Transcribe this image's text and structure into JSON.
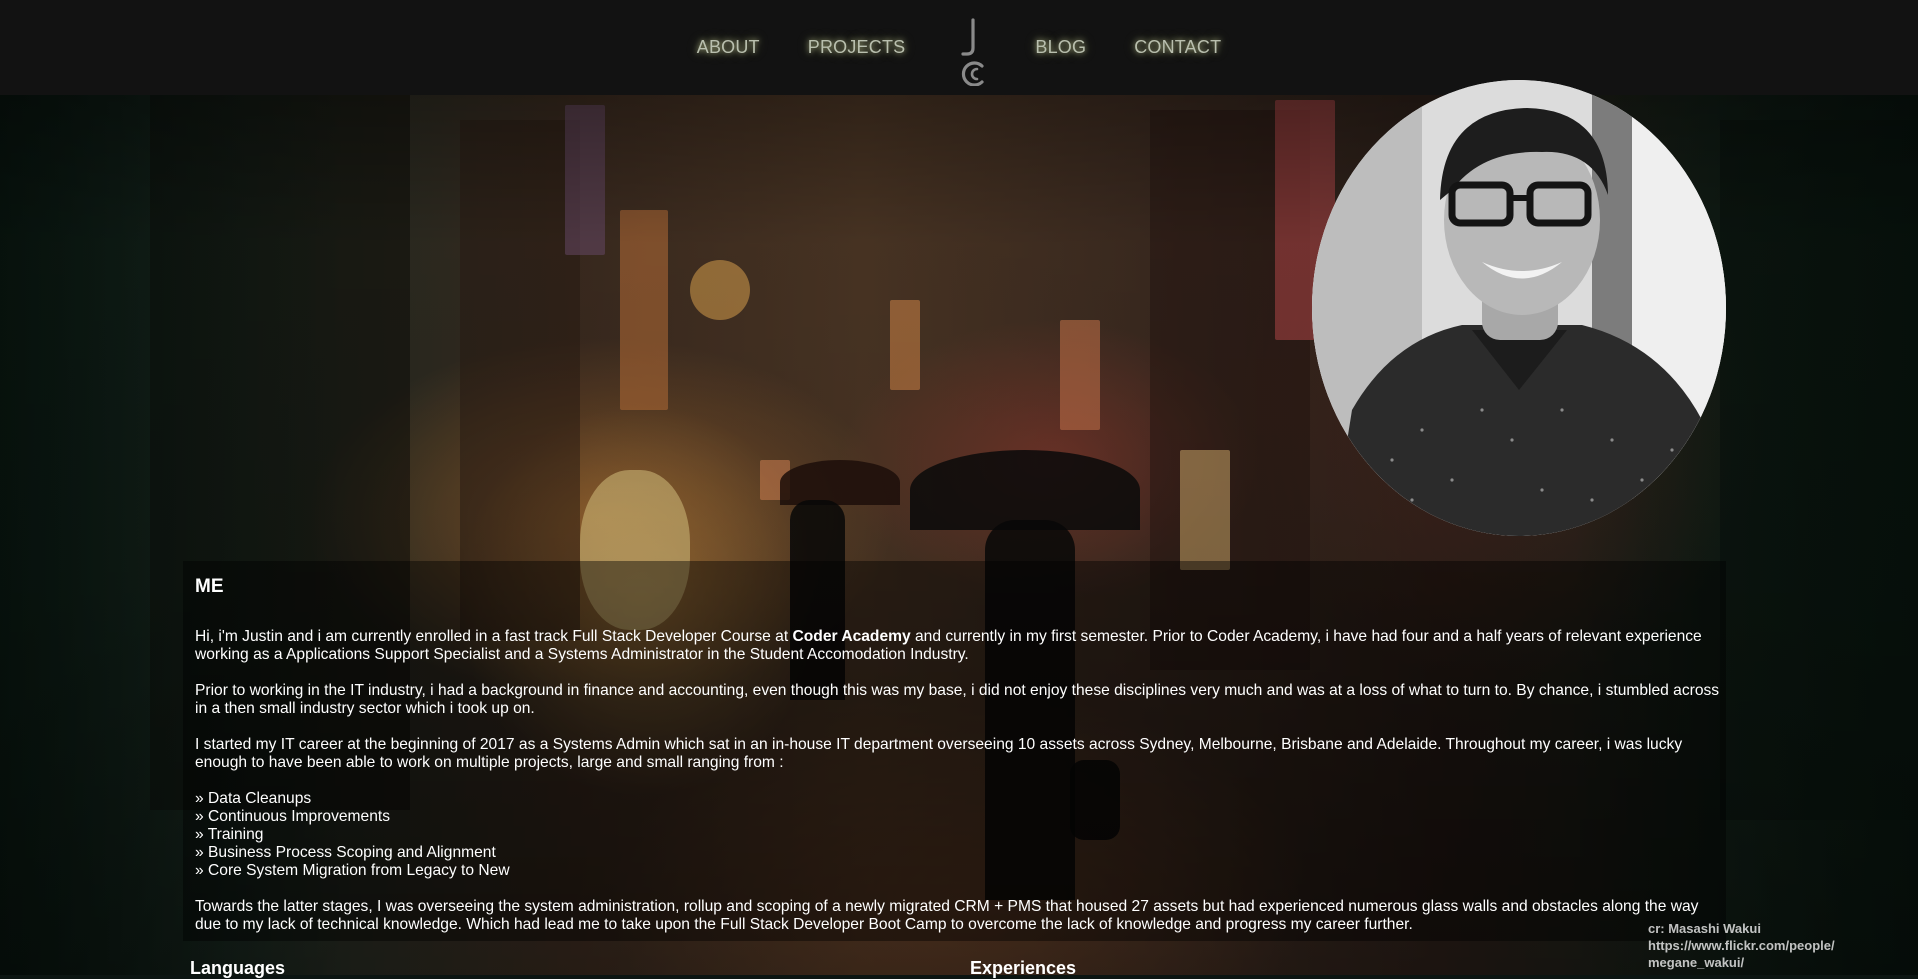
{
  "nav": {
    "links": [
      "ABOUT",
      "PROJECTS",
      "BLOG",
      "CONTACT"
    ],
    "logo_text": "JC"
  },
  "about": {
    "heading": "ME",
    "p1_before": "Hi, i'm Justin and i am currently enrolled in a fast track Full Stack Developer Course at ",
    "p1_bold": "Coder Academy",
    "p1_after": " and currently in my first semester. Prior to Coder Academy, i have had four and a half years of relevant experience working as a Applications Support Specialist and a Systems Administrator in the Student Accomodation Industry.",
    "p2": "Prior to working in the IT industry, i had a background in finance and accounting, even though this was my base, i did not enjoy these disciplines very much and was at a loss of what to turn to. By chance, i stumbled across in a then small industry sector which i took up on.",
    "p3": "I started my IT career at the beginning of 2017 as a Systems Admin which sat in an in-house IT department overseeing 10 assets across Sydney, Melbourne, Brisbane and Adelaide. Throughout my career, i was lucky enough to have been able to work on multiple projects, large and small ranging from :",
    "items": [
      "» Data Cleanups",
      "» Continuous Improvements",
      "» Training",
      "» Business Process Scoping and Alignment",
      "» Core System Migration from Legacy to New"
    ],
    "p4": "Towards the latter stages, I was overseeing the system administration, rollup and scoping of a newly migrated CRM + PMS that housed 27 assets but had experienced numerous glass walls and obstacles along the way due to my lack of technical knowledge. Which had lead me to take upon the Full Stack Developer Boot Camp to overcome the lack of knowledge and progress my career further."
  },
  "sections": {
    "languages": "Languages",
    "experiences": "Experiences"
  },
  "credit": {
    "line1": "cr: Masashi Wakui",
    "line2": "https://www.flickr.com/people/",
    "line3": "megane_wakui/"
  },
  "colors": {
    "nav_bg": "#121212",
    "nav_link": "#b9bfae",
    "nav_glow": "#e1ebaa"
  }
}
